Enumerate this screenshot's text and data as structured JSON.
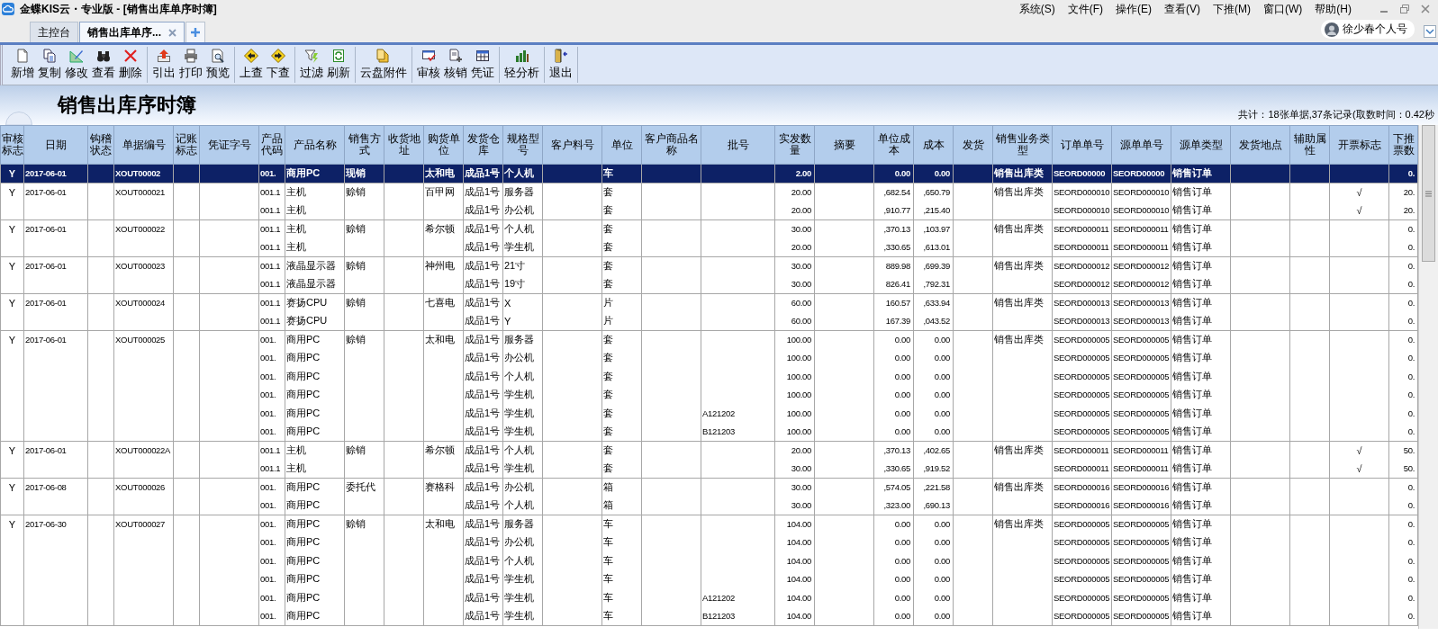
{
  "window": {
    "title": "金蝶KIS云・专业版 - [销售出库单序时簿]"
  },
  "menu": [
    "系统(S)",
    "文件(F)",
    "操作(E)",
    "查看(V)",
    "下推(M)",
    "窗口(W)",
    "帮助(H)"
  ],
  "tabs": [
    {
      "label": "主控台",
      "selected": false,
      "closable": false
    },
    {
      "label": "销售出库单序...",
      "selected": true,
      "closable": true
    }
  ],
  "user": {
    "name": "徐少春个人号"
  },
  "toolbar": {
    "groups": [
      [
        "新增",
        "复制",
        "修改",
        "查看",
        "删除"
      ],
      [
        "引出",
        "打印",
        "预览"
      ],
      [
        "上查",
        "下查"
      ],
      [
        "过滤",
        "刷新"
      ],
      [
        "云盘附件"
      ],
      [
        "审核",
        "核销",
        "凭证"
      ],
      [
        "轻分析"
      ],
      [
        "退出"
      ]
    ]
  },
  "report": {
    "title": "销售出库序时簿",
    "summary": "共计：18张单据,37条记录(取数时间：0.42秒"
  },
  "table": {
    "columns": [
      "审核标志",
      "日期",
      "钩稽状态",
      "单据编号",
      "记账标志",
      "凭证字号",
      "产品代码",
      "产品名称",
      "销售方式",
      "收货地址",
      "购货单位",
      "发货仓库",
      "规格型号",
      "客户料号",
      "单位",
      "客户商品名称",
      "批号",
      "实发数量",
      "摘要",
      "单位成本",
      "成本",
      "发货",
      "销售业务类型",
      "订单单号",
      "源单单号",
      "源单类型",
      "发货地点",
      "辅助属性",
      "开票标志",
      "下推票数"
    ],
    "groups": [
      {
        "rows": [
          {
            "selected": true,
            "audit": "Y",
            "date": "2017-06-01",
            "bill_no": "XOUT00002",
            "code": "001.",
            "product": "商用PC",
            "sale_mode": "现销",
            "buyer": "太和电",
            "warehouse": "成品1号",
            "spec": "个人机",
            "unit": "车",
            "qty": "2.00",
            "unit_cost": "0.00",
            "cost": "0.00",
            "biz_type": "销售出库类",
            "order_no": "SEORD00000",
            "source_no": "SEORD00000",
            "source_type": "销售订单",
            "push_qty": "0."
          }
        ]
      },
      {
        "rows": [
          {
            "selected": false,
            "audit": "Y",
            "date": "2017-06-01",
            "bill_no": "XOUT000021",
            "code": "001.1",
            "product": "主机",
            "sale_mode": "赊销",
            "buyer": "百甲网",
            "warehouse": "成品1号",
            "spec": "服务器",
            "unit": "套",
            "qty": "20.00",
            "unit_cost": ",682.54",
            "cost": ",650.79",
            "biz_type": "销售出库类",
            "order_no": "SEORD000010",
            "source_no": "SEORD000010",
            "source_type": "销售订单",
            "invoice": "√",
            "push_qty": "20."
          },
          {
            "selected": false,
            "code": "001.1",
            "product": "主机",
            "warehouse": "成品1号",
            "spec": "办公机",
            "unit": "套",
            "qty": "20.00",
            "unit_cost": ",910.77",
            "cost": ",215.40",
            "order_no": "SEORD000010",
            "source_no": "SEORD000010",
            "source_type": "销售订单",
            "invoice": "√",
            "push_qty": "20."
          }
        ]
      },
      {
        "rows": [
          {
            "selected": false,
            "audit": "Y",
            "date": "2017-06-01",
            "bill_no": "XOUT000022",
            "code": "001.1",
            "product": "主机",
            "sale_mode": "赊销",
            "buyer": "希尔顿",
            "warehouse": "成品1号",
            "spec": "个人机",
            "unit": "套",
            "qty": "30.00",
            "unit_cost": ",370.13",
            "cost": ",103.97",
            "biz_type": "销售出库类",
            "order_no": "SEORD000011",
            "source_no": "SEORD000011",
            "source_type": "销售订单",
            "push_qty": "0."
          },
          {
            "selected": false,
            "code": "001.1",
            "product": "主机",
            "warehouse": "成品1号",
            "spec": "学生机",
            "unit": "套",
            "qty": "20.00",
            "unit_cost": ",330.65",
            "cost": ",613.01",
            "order_no": "SEORD000011",
            "source_no": "SEORD000011",
            "source_type": "销售订单",
            "push_qty": "0."
          }
        ]
      },
      {
        "rows": [
          {
            "selected": false,
            "audit": "Y",
            "date": "2017-06-01",
            "bill_no": "XOUT000023",
            "code": "001.1",
            "product": "液晶显示器",
            "sale_mode": "赊销",
            "buyer": "神州电",
            "warehouse": "成品1号",
            "spec": "21寸",
            "unit": "套",
            "qty": "30.00",
            "unit_cost": "889.98",
            "cost": ",699.39",
            "biz_type": "销售出库类",
            "order_no": "SEORD000012",
            "source_no": "SEORD000012",
            "source_type": "销售订单",
            "push_qty": "0."
          },
          {
            "selected": false,
            "code": "001.1",
            "product": "液晶显示器",
            "warehouse": "成品1号",
            "spec": "19寸",
            "unit": "套",
            "qty": "30.00",
            "unit_cost": "826.41",
            "cost": ",792.31",
            "order_no": "SEORD000012",
            "source_no": "SEORD000012",
            "source_type": "销售订单",
            "push_qty": "0."
          }
        ]
      },
      {
        "rows": [
          {
            "selected": false,
            "audit": "Y",
            "date": "2017-06-01",
            "bill_no": "XOUT000024",
            "code": "001.1",
            "product": "赛扬CPU",
            "sale_mode": "赊销",
            "buyer": "七喜电",
            "warehouse": "成品1号",
            "spec": "X",
            "unit": "片",
            "qty": "60.00",
            "unit_cost": "160.57",
            "cost": ",633.94",
            "biz_type": "销售出库类",
            "order_no": "SEORD000013",
            "source_no": "SEORD000013",
            "source_type": "销售订单",
            "push_qty": "0."
          },
          {
            "selected": false,
            "code": "001.1",
            "product": "赛扬CPU",
            "warehouse": "成品1号",
            "spec": "Y",
            "unit": "片",
            "qty": "60.00",
            "unit_cost": "167.39",
            "cost": ",043.52",
            "order_no": "SEORD000013",
            "source_no": "SEORD000013",
            "source_type": "销售订单",
            "push_qty": "0."
          }
        ]
      },
      {
        "rows": [
          {
            "selected": false,
            "audit": "Y",
            "date": "2017-06-01",
            "bill_no": "XOUT000025",
            "code": "001.",
            "product": "商用PC",
            "sale_mode": "赊销",
            "buyer": "太和电",
            "warehouse": "成品1号",
            "spec": "服务器",
            "unit": "套",
            "qty": "100.00",
            "unit_cost": "0.00",
            "cost": "0.00",
            "biz_type": "销售出库类",
            "order_no": "SEORD000005",
            "source_no": "SEORD000005",
            "source_type": "销售订单",
            "push_qty": "0."
          },
          {
            "selected": false,
            "code": "001.",
            "product": "商用PC",
            "warehouse": "成品1号",
            "spec": "办公机",
            "unit": "套",
            "qty": "100.00",
            "unit_cost": "0.00",
            "cost": "0.00",
            "order_no": "SEORD000005",
            "source_no": "SEORD000005",
            "source_type": "销售订单",
            "push_qty": "0."
          },
          {
            "selected": false,
            "code": "001.",
            "product": "商用PC",
            "warehouse": "成品1号",
            "spec": "个人机",
            "unit": "套",
            "qty": "100.00",
            "unit_cost": "0.00",
            "cost": "0.00",
            "order_no": "SEORD000005",
            "source_no": "SEORD000005",
            "source_type": "销售订单",
            "push_qty": "0."
          },
          {
            "selected": false,
            "code": "001.",
            "product": "商用PC",
            "warehouse": "成品1号",
            "spec": "学生机",
            "unit": "套",
            "qty": "100.00",
            "unit_cost": "0.00",
            "cost": "0.00",
            "order_no": "SEORD000005",
            "source_no": "SEORD000005",
            "source_type": "销售订单",
            "push_qty": "0."
          },
          {
            "selected": false,
            "code": "001.",
            "product": "商用PC",
            "warehouse": "成品1号",
            "spec": "学生机",
            "unit": "套",
            "batch": "A121202",
            "qty": "100.00",
            "unit_cost": "0.00",
            "cost": "0.00",
            "order_no": "SEORD000005",
            "source_no": "SEORD000005",
            "source_type": "销售订单",
            "push_qty": "0."
          },
          {
            "selected": false,
            "code": "001.",
            "product": "商用PC",
            "warehouse": "成品1号",
            "spec": "学生机",
            "unit": "套",
            "batch": "B121203",
            "qty": "100.00",
            "unit_cost": "0.00",
            "cost": "0.00",
            "order_no": "SEORD000005",
            "source_no": "SEORD000005",
            "source_type": "销售订单",
            "push_qty": "0."
          }
        ]
      },
      {
        "rows": [
          {
            "selected": false,
            "audit": "Y",
            "date": "2017-06-01",
            "bill_no": "XOUT000022A",
            "code": "001.1",
            "product": "主机",
            "sale_mode": "赊销",
            "buyer": "希尔顿",
            "warehouse": "成品1号",
            "spec": "个人机",
            "unit": "套",
            "qty": "20.00",
            "unit_cost": ",370.13",
            "cost": ",402.65",
            "biz_type": "销售出库类",
            "order_no": "SEORD000011",
            "source_no": "SEORD000011",
            "source_type": "销售订单",
            "invoice": "√",
            "push_qty": "50."
          },
          {
            "selected": false,
            "code": "001.1",
            "product": "主机",
            "warehouse": "成品1号",
            "spec": "学生机",
            "unit": "套",
            "qty": "30.00",
            "unit_cost": ",330.65",
            "cost": ",919.52",
            "order_no": "SEORD000011",
            "source_no": "SEORD000011",
            "source_type": "销售订单",
            "invoice": "√",
            "push_qty": "50."
          }
        ]
      },
      {
        "rows": [
          {
            "selected": false,
            "audit": "Y",
            "date": "2017-06-08",
            "bill_no": "XOUT000026",
            "code": "001.",
            "product": "商用PC",
            "sale_mode": "委托代",
            "buyer": "赛格科",
            "warehouse": "成品1号",
            "spec": "办公机",
            "unit": "箱",
            "qty": "30.00",
            "unit_cost": ",574.05",
            "cost": ",221.58",
            "biz_type": "销售出库类",
            "order_no": "SEORD000016",
            "source_no": "SEORD000016",
            "source_type": "销售订单",
            "push_qty": "0."
          },
          {
            "selected": false,
            "code": "001.",
            "product": "商用PC",
            "warehouse": "成品1号",
            "spec": "个人机",
            "unit": "箱",
            "qty": "30.00",
            "unit_cost": ",323.00",
            "cost": ",690.13",
            "order_no": "SEORD000016",
            "source_no": "SEORD000016",
            "source_type": "销售订单",
            "push_qty": "0."
          }
        ]
      },
      {
        "rows": [
          {
            "selected": false,
            "audit": "Y",
            "date": "2017-06-30",
            "bill_no": "XOUT000027",
            "code": "001.",
            "product": "商用PC",
            "sale_mode": "赊销",
            "buyer": "太和电",
            "warehouse": "成品1号",
            "spec": "服务器",
            "unit": "车",
            "qty": "104.00",
            "unit_cost": "0.00",
            "cost": "0.00",
            "biz_type": "销售出库类",
            "order_no": "SEORD000005",
            "source_no": "SEORD000005",
            "source_type": "销售订单",
            "push_qty": "0."
          },
          {
            "selected": false,
            "code": "001.",
            "product": "商用PC",
            "warehouse": "成品1号",
            "spec": "办公机",
            "unit": "车",
            "qty": "104.00",
            "unit_cost": "0.00",
            "cost": "0.00",
            "order_no": "SEORD000005",
            "source_no": "SEORD000005",
            "source_type": "销售订单",
            "push_qty": "0."
          },
          {
            "selected": false,
            "code": "001.",
            "product": "商用PC",
            "warehouse": "成品1号",
            "spec": "个人机",
            "unit": "车",
            "qty": "104.00",
            "unit_cost": "0.00",
            "cost": "0.00",
            "order_no": "SEORD000005",
            "source_no": "SEORD000005",
            "source_type": "销售订单",
            "push_qty": "0."
          },
          {
            "selected": false,
            "code": "001.",
            "product": "商用PC",
            "warehouse": "成品1号",
            "spec": "学生机",
            "unit": "车",
            "qty": "104.00",
            "unit_cost": "0.00",
            "cost": "0.00",
            "order_no": "SEORD000005",
            "source_no": "SEORD000005",
            "source_type": "销售订单",
            "push_qty": "0."
          },
          {
            "selected": false,
            "code": "001.",
            "product": "商用PC",
            "warehouse": "成品1号",
            "spec": "学生机",
            "unit": "车",
            "batch": "A121202",
            "qty": "104.00",
            "unit_cost": "0.00",
            "cost": "0.00",
            "order_no": "SEORD000005",
            "source_no": "SEORD000005",
            "source_type": "销售订单",
            "push_qty": "0."
          },
          {
            "selected": false,
            "code": "001.",
            "product": "商用PC",
            "warehouse": "成品1号",
            "spec": "学生机",
            "unit": "车",
            "batch": "B121203",
            "qty": "104.00",
            "unit_cost": "0.00",
            "cost": "0.00",
            "order_no": "SEORD000005",
            "source_no": "SEORD000005",
            "source_type": "销售订单",
            "push_qty": "0."
          }
        ]
      }
    ]
  }
}
